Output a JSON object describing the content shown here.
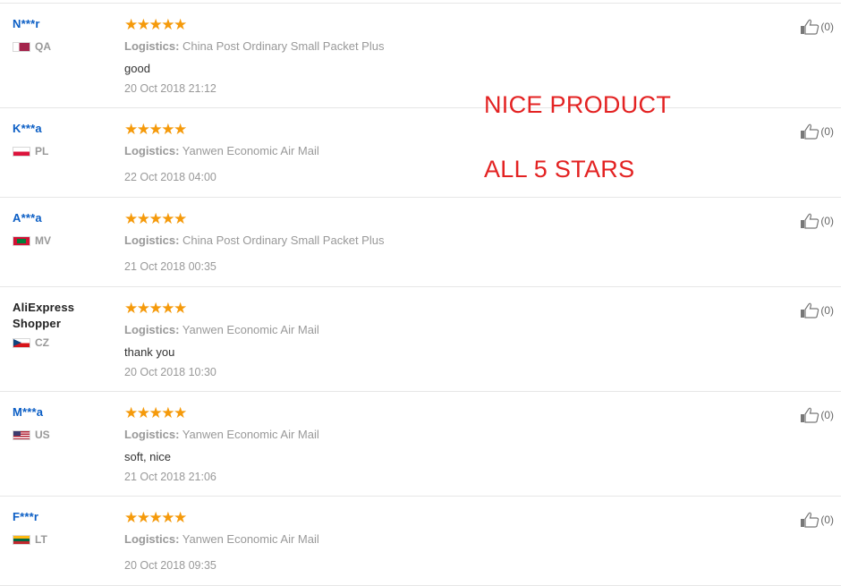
{
  "reviews": [
    {
      "name": "N***r",
      "country": "QA",
      "flag": "qa",
      "stars": "★★★★★",
      "logistics_label": "Logistics:",
      "logistics": "China Post Ordinary Small Packet Plus",
      "comment": "good",
      "date": "20 Oct 2018 21:12",
      "likes": "(0)"
    },
    {
      "name": "K***a",
      "country": "PL",
      "flag": "pl",
      "stars": "★★★★★",
      "logistics_label": "Logistics:",
      "logistics": "Yanwen Economic Air Mail",
      "comment": "",
      "date": "22 Oct 2018 04:00",
      "likes": "(0)"
    },
    {
      "name": "A***a",
      "country": "MV",
      "flag": "mv",
      "stars": "★★★★★",
      "logistics_label": "Logistics:",
      "logistics": "China Post Ordinary Small Packet Plus",
      "comment": "",
      "date": "21 Oct 2018 00:35",
      "likes": "(0)"
    },
    {
      "name": "AliExpress Shopper",
      "country": "CZ",
      "flag": "cz",
      "stars": "★★★★★",
      "logistics_label": "Logistics:",
      "logistics": "Yanwen Economic Air Mail",
      "comment": "thank you",
      "date": "20 Oct 2018 10:30",
      "likes": "(0)"
    },
    {
      "name": "M***a",
      "country": "US",
      "flag": "us",
      "stars": "★★★★★",
      "logistics_label": "Logistics:",
      "logistics": "Yanwen Economic Air Mail",
      "comment": "soft, nice",
      "date": "21 Oct 2018 21:06",
      "likes": "(0)"
    },
    {
      "name": "F***r",
      "country": "LT",
      "flag": "lt",
      "stars": "★★★★★",
      "logistics_label": "Logistics:",
      "logistics": "Yanwen Economic Air Mail",
      "comment": "",
      "date": "20 Oct 2018 09:35",
      "likes": "(0)"
    }
  ],
  "overlay": {
    "line1": "NICE PRODUCT",
    "line2": "ALL 5 STARS"
  },
  "colors": {
    "user_link": "#0b5ec5",
    "stars": "#f59a0b",
    "overlay_text": "#e32222",
    "muted": "#999999"
  },
  "icons": {
    "like": "thumbs-up-icon",
    "star": "star-icon"
  }
}
